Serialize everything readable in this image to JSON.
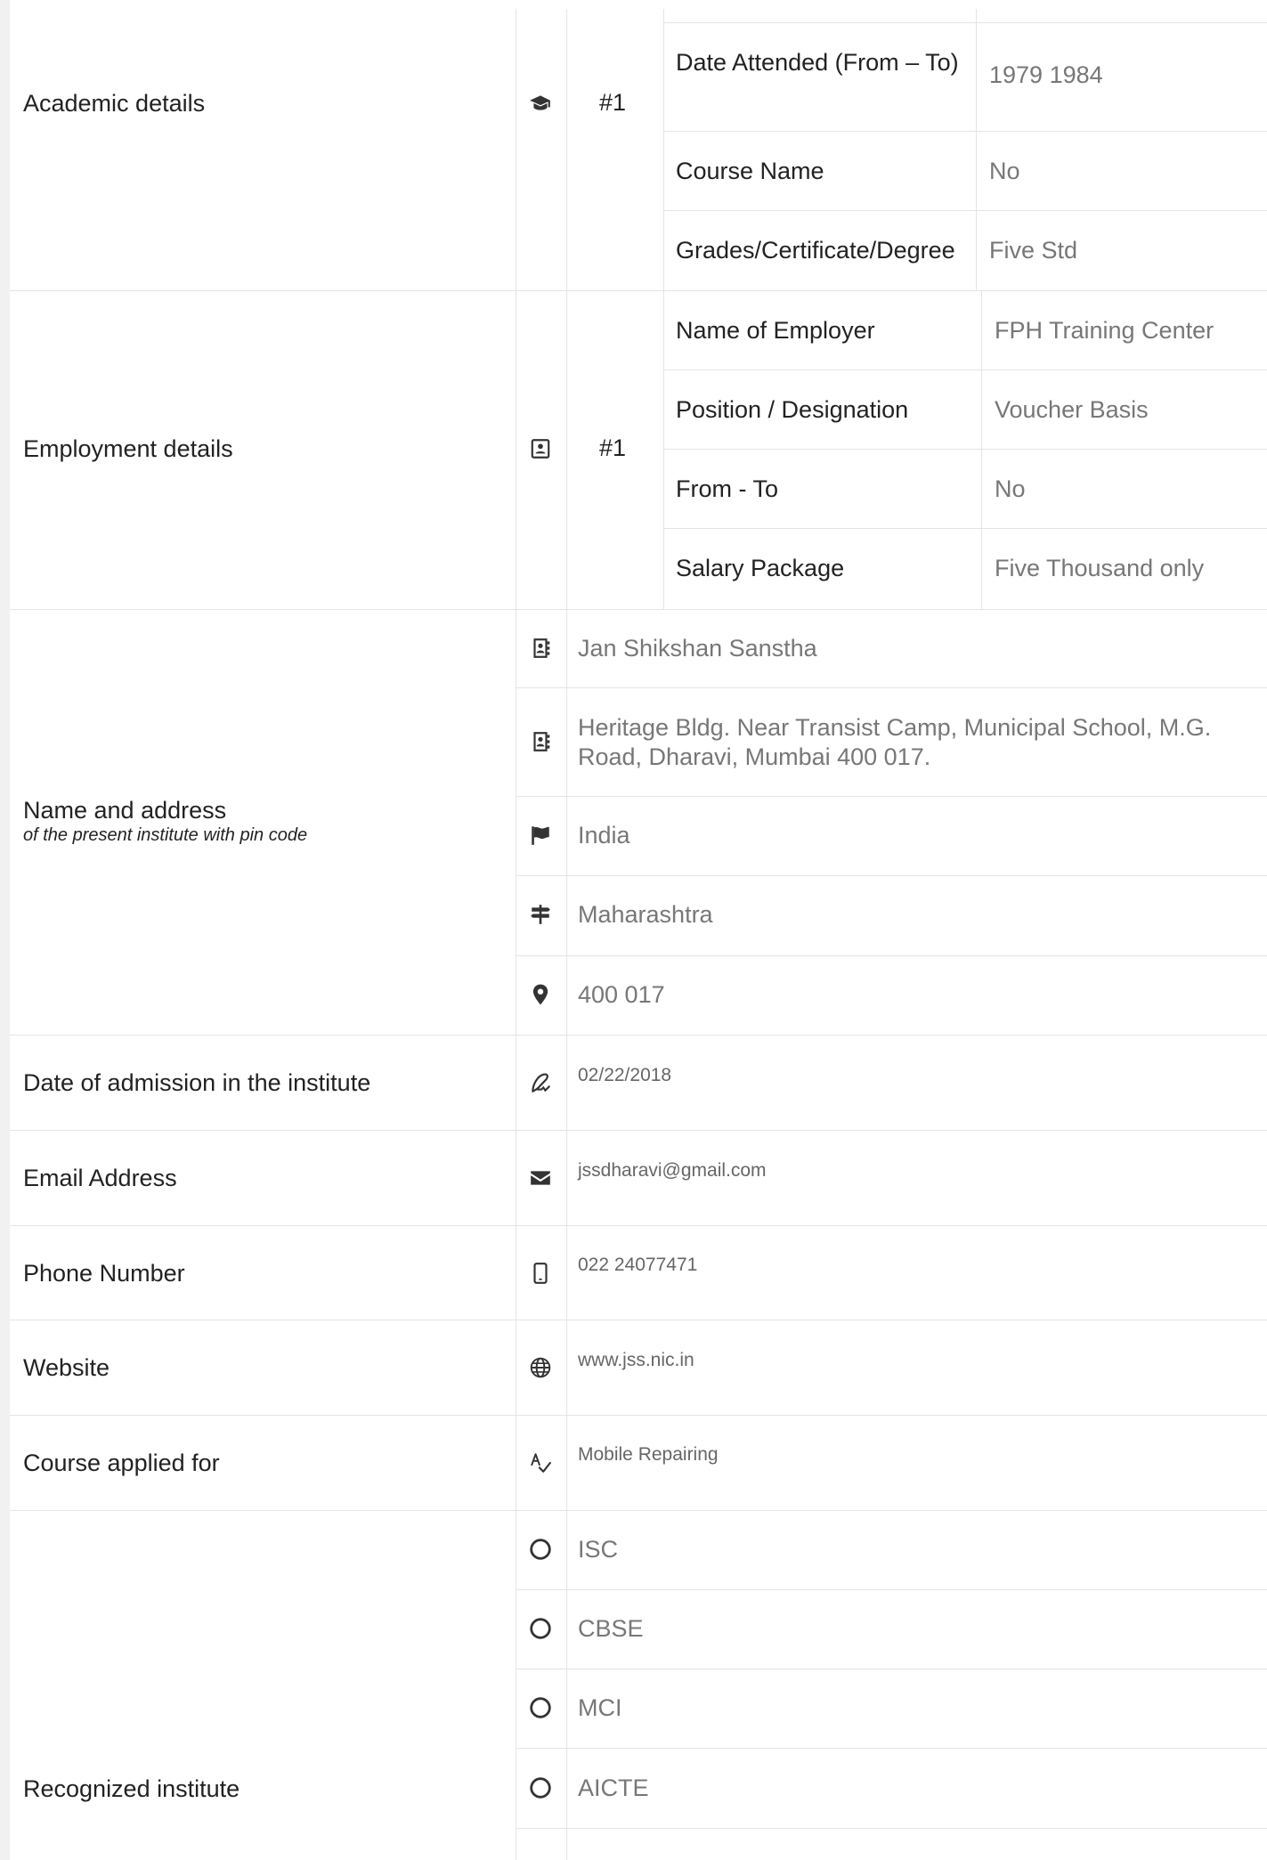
{
  "academic": {
    "label": "Academic details",
    "index": "#1",
    "rows": [
      {
        "key": "Date Attended (From – To)",
        "value": "1979 1984"
      },
      {
        "key": "Course Name",
        "value": "No"
      },
      {
        "key": "Grades/Certificate/Degree",
        "value": "Five Std"
      }
    ]
  },
  "employment": {
    "label": "Employment details",
    "index": "#1",
    "rows": [
      {
        "key": "Name of Employer",
        "value": "FPH Training Center"
      },
      {
        "key": "Position / Designation",
        "value": "Voucher Basis"
      },
      {
        "key": "From - To",
        "value": "No"
      },
      {
        "key": "Salary Package",
        "value": "Five Thousand only"
      }
    ]
  },
  "institute": {
    "label": "Name and address",
    "sublabel": "of the present institute with pin code",
    "name": "Jan Shikshan Sanstha",
    "address": "Heritage Bldg. Near Transist Camp, Municipal School, M.G. Road, Dharavi, Mumbai 400 017.",
    "country": "India",
    "state": "Maharashtra",
    "pin": "400 017"
  },
  "admission": {
    "label": "Date of admission in the institute",
    "value": "02/22/2018"
  },
  "email": {
    "label": "Email Address",
    "value": "jssdharavi@gmail.com"
  },
  "phone": {
    "label": "Phone Number",
    "value": "022 24077471"
  },
  "website": {
    "label": "Website",
    "value": "www.jss.nic.in"
  },
  "course": {
    "label": "Course applied for",
    "value": "Mobile Repairing"
  },
  "recognized": {
    "label": "Recognized institute",
    "options": [
      "ISC",
      "CBSE",
      "MCI",
      "AICTE"
    ]
  },
  "icons": {
    "academic": "graduation-cap-icon",
    "employment": "id-card-icon",
    "name": "address-book-icon",
    "address": "address-book-icon",
    "country": "flag-icon",
    "state": "signpost-icon",
    "pin": "map-marker-icon",
    "admission": "signature-icon",
    "email": "envelope-icon",
    "phone": "mobile-icon",
    "website": "globe-icon",
    "course": "spell-check-icon",
    "radio": "radio-circle-icon"
  }
}
